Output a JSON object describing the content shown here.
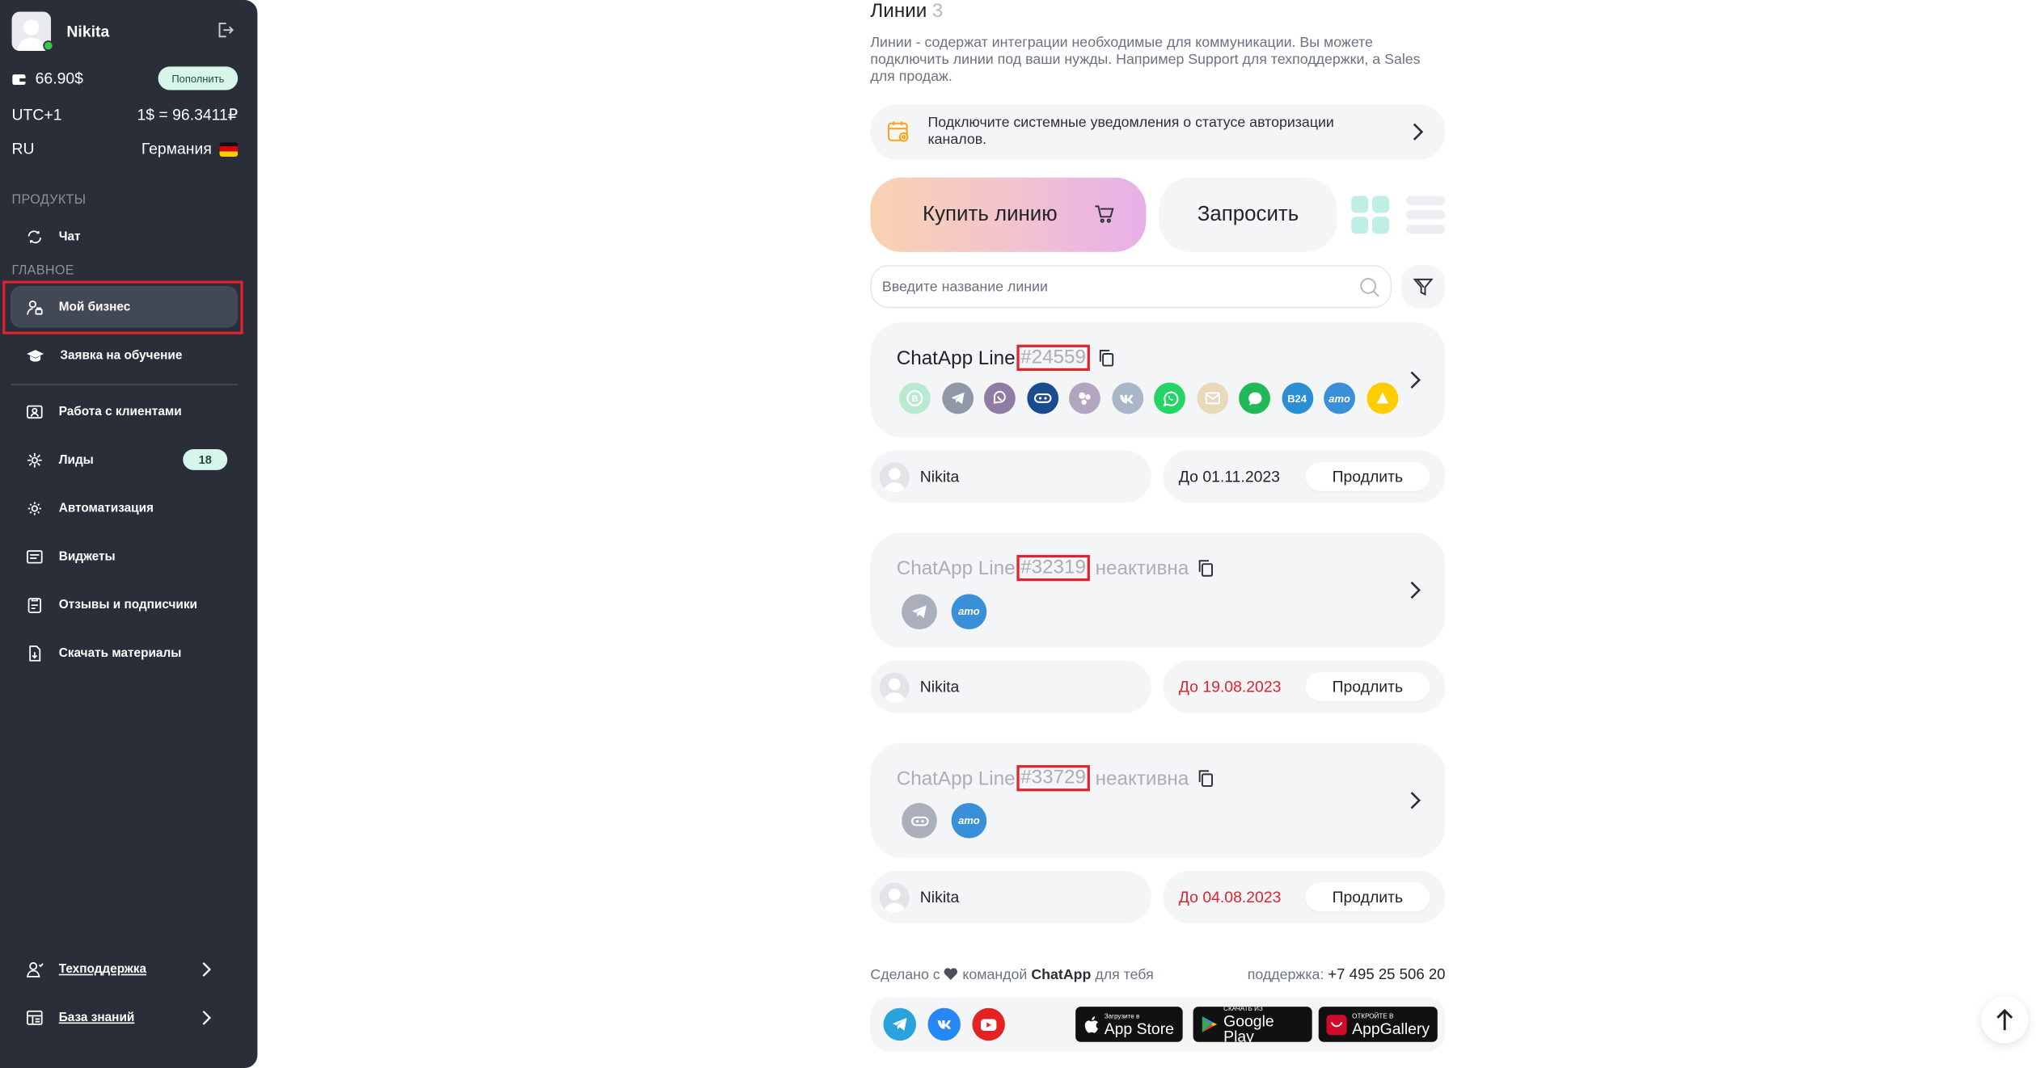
{
  "sidebar": {
    "user_name": "Nikita",
    "balance": "66.90$",
    "topup_label": "Пополнить",
    "timezone": "UTC+1",
    "rate": "1$ = 96.3411₽",
    "language": "RU",
    "country": "Германия",
    "section_products": "ПРОДУКТЫ",
    "section_main": "ГЛАВНОЕ",
    "items": {
      "chat": "Чат",
      "my_business": "Мой бизнес",
      "training": "Заявка на обучение",
      "clients": "Работа с клиентами",
      "leads": "Лиды",
      "leads_badge": "18",
      "automation": "Автоматизация",
      "widgets": "Виджеты",
      "reviews": "Отзывы и подписчики",
      "downloads": "Скачать материалы",
      "support": "Техподдержка",
      "knowledge": "База знаний"
    }
  },
  "main": {
    "title": "Линии",
    "count": "3",
    "description": "Линии - содержат интеграции необходимые для коммуникации. Вы можете подключить линии под ваши нужды. Например Support для техподдержки, а Sales для продаж.",
    "notify_text": "Подключите системные уведомления о статусе авторизации каналов.",
    "buy_label": "Купить линию",
    "request_label": "Запросить",
    "search_placeholder": "Введите название линии",
    "lines": [
      {
        "name": "ChatApp Line",
        "number": "#24559",
        "status": "",
        "owner": "Nikita",
        "until": "До 01.11.2023",
        "extend": "Продлить"
      },
      {
        "name": "ChatApp Line",
        "number": "#32319",
        "status": " неактивна",
        "owner": "Nikita",
        "until": "До 19.08.2023",
        "extend": "Продлить"
      },
      {
        "name": "ChatApp Line",
        "number": "#33729",
        "status": " неактивна",
        "owner": "Nikita",
        "until": "До 04.08.2023",
        "extend": "Продлить"
      }
    ],
    "channel_labels": {
      "b24": "B24",
      "amo": "amo"
    }
  },
  "footer": {
    "made_prefix": "Сделано с",
    "made_middle": "командой",
    "brand": "ChatApp",
    "made_suffix": "для тебя",
    "support_label": "поддержка:",
    "phone": "+7 495 25 506 20",
    "appstore_small": "Загрузите в",
    "appstore_big": "App Store",
    "gplay_small": "СКАЧАТЬ ИЗ",
    "gplay_big": "Google Play",
    "appgallery_small": "ОТКРОЙТЕ В",
    "appgallery_big": "AppGallery"
  },
  "colors": {
    "sidebar_bg": "#2a2e38",
    "accent_red": "#e0232e",
    "badge_bg": "#d8f5ec",
    "card_bg": "#f4f5f7"
  }
}
